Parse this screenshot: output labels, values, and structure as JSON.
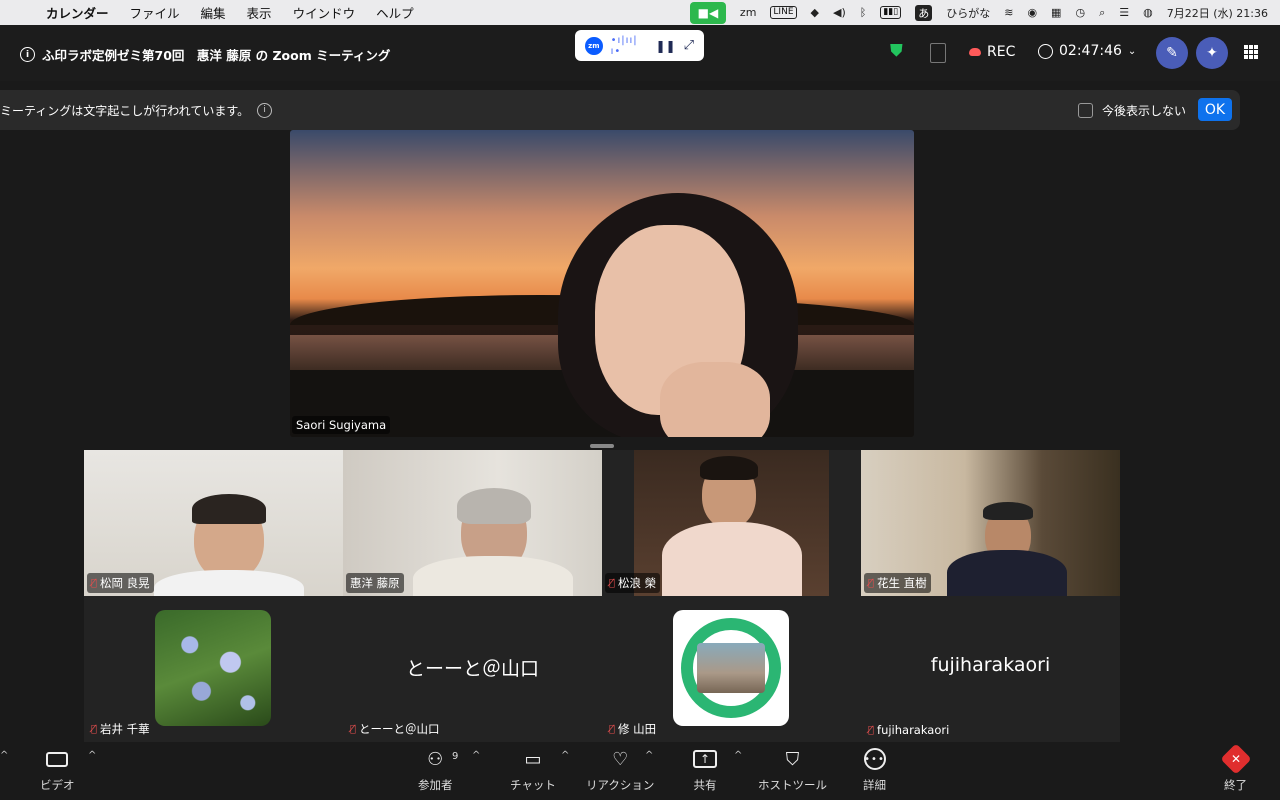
{
  "menubar": {
    "apple": "",
    "items": [
      "カレンダー",
      "ファイル",
      "編集",
      "表示",
      "ウインドウ",
      "ヘルプ"
    ],
    "ime_badge": "あ",
    "ime_label": "ひらがな",
    "datetime": "7月22日 (水)  21:36"
  },
  "meeting": {
    "title": "ふ印ラボ定例ゼミ第70回　惠洋 藤原 の Zoom ミーティング",
    "rec_label": "REC",
    "timer": "02:47:46"
  },
  "mini_widget": {
    "badge": "zm",
    "wave": "•ı|ıı|ı•"
  },
  "notice": {
    "message": "ミーティングは文字起こしが行われています。",
    "checkbox_label": "今後表示しない",
    "ok_label": "OK"
  },
  "active_speaker": {
    "name": "Saori Sugiyama"
  },
  "gallery": [
    {
      "name": "松岡 良晃",
      "muted": true
    },
    {
      "name": "惠洋 藤原",
      "muted": false
    },
    {
      "name": "松浪 榮",
      "muted": true
    },
    {
      "name": "花生 直樹",
      "muted": true
    },
    {
      "name": "岩井 千華",
      "muted": true
    },
    {
      "name": "とーーと＠山口",
      "muted": true,
      "display": "とーーと＠山口"
    },
    {
      "name": "修 山田",
      "muted": true
    },
    {
      "name": "fujiharakaori",
      "muted": true,
      "display": "fujiharakaori"
    }
  ],
  "toolbar": {
    "video": "ビデオ",
    "participants": "参加者",
    "participants_count": "9",
    "chat": "チャット",
    "reactions": "リアクション",
    "share": "共有",
    "host_tools": "ホストツール",
    "more": "詳細",
    "end": "終了"
  },
  "colors": {
    "zoom_blue": "#0e72ed",
    "end_red": "#e02e2e",
    "mute_red": "#e24d4d",
    "menubar_green": "#2db84d"
  }
}
